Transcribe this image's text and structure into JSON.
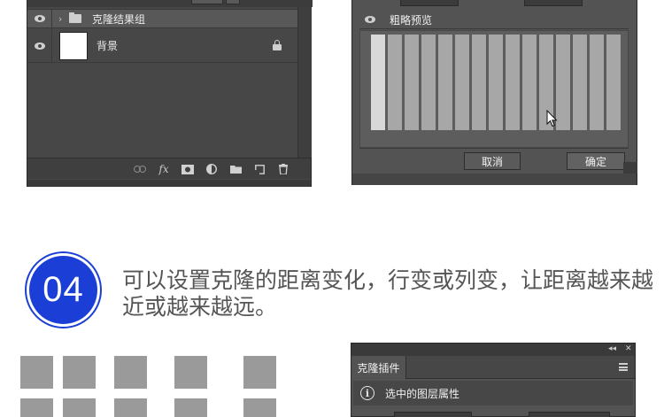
{
  "layers_panel": {
    "layers": [
      {
        "name": "克隆结果组",
        "type": "group"
      },
      {
        "name": "背景",
        "type": "background",
        "locked": true
      }
    ],
    "footer_icons": [
      "link-icon",
      "fx-icon",
      "mask-icon",
      "adjustment-icon",
      "folder-icon",
      "new-layer-icon",
      "trash-icon"
    ],
    "footer_fx_label": "fx"
  },
  "clone_dialog": {
    "preview_label": "粗略预览",
    "bar_count": 15,
    "cancel_label": "取消",
    "ok_label": "确定"
  },
  "step": {
    "number": "04",
    "text": "可以设置克隆的距离变化，行变或列变，让距离越来越近或越来越远。"
  },
  "squares": {
    "color": "#9a9a9a"
  },
  "plugin_panel": {
    "tab_label": "克隆插件",
    "section_label": "选中的图层属性",
    "collapse_glyph": "◂◂",
    "close_glyph": "✕"
  },
  "colors": {
    "badge_blue": "#1b3fd6",
    "panel_dark": "#474747",
    "text_gray": "#555555"
  }
}
